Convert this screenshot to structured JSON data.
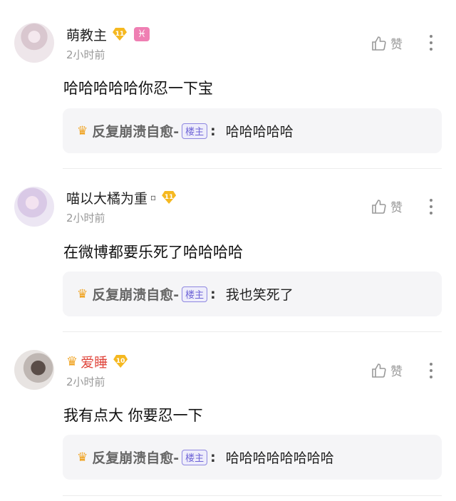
{
  "like_label": "赞",
  "comments": [
    {
      "username": "萌教主",
      "level": "11",
      "zodiac_symbol": "♓",
      "time": "2小时前",
      "text": "哈哈哈哈哈你忍一下宝",
      "reply": {
        "author": "反复崩溃自愈-",
        "badge": "楼主",
        "text": "哈哈哈哈哈"
      }
    },
    {
      "username": "喵以大橘为重",
      "level": "11",
      "trailing_symbol": "▫",
      "time": "2小时前",
      "text": "在微博都要乐死了哈哈哈哈",
      "reply": {
        "author": "反复崩溃自愈-",
        "badge": "楼主",
        "text": "我也笑死了"
      }
    },
    {
      "username": "爱睡",
      "level": "10",
      "time": "2小时前",
      "text": "我有点大 你要忍一下",
      "reply": {
        "author": "反复崩溃自愈-",
        "badge": "楼主",
        "text": "哈哈哈哈哈哈哈哈"
      }
    }
  ]
}
